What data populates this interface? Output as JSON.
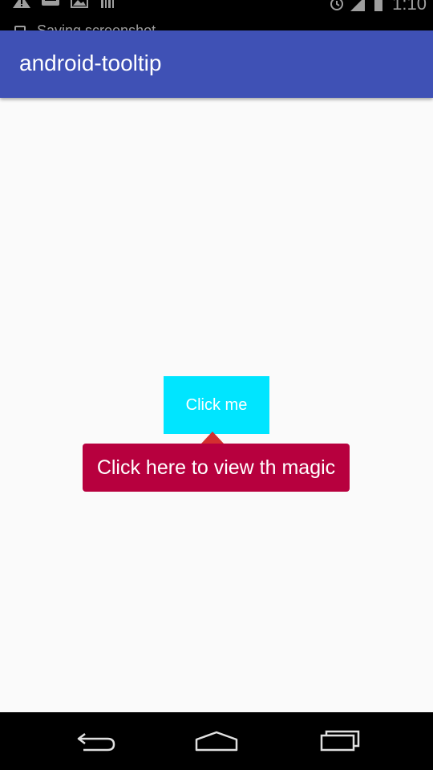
{
  "status_bar": {
    "time": "1:10",
    "notification_text": "Saving screenshot",
    "icons": [
      "warning-icon",
      "message-icon",
      "image-icon",
      "barcode-icon",
      "alarm-icon",
      "signal-icon",
      "battery-icon"
    ]
  },
  "app_bar": {
    "title": "android-tooltip",
    "color": "#3f51b5"
  },
  "main": {
    "button_label": "Click me",
    "button_color": "#00e5ff",
    "tooltip_text": "Click here to view th magic",
    "tooltip_color": "#b7003e"
  },
  "nav_bar": {
    "icons": [
      "back-icon",
      "home-icon",
      "recents-icon"
    ]
  }
}
